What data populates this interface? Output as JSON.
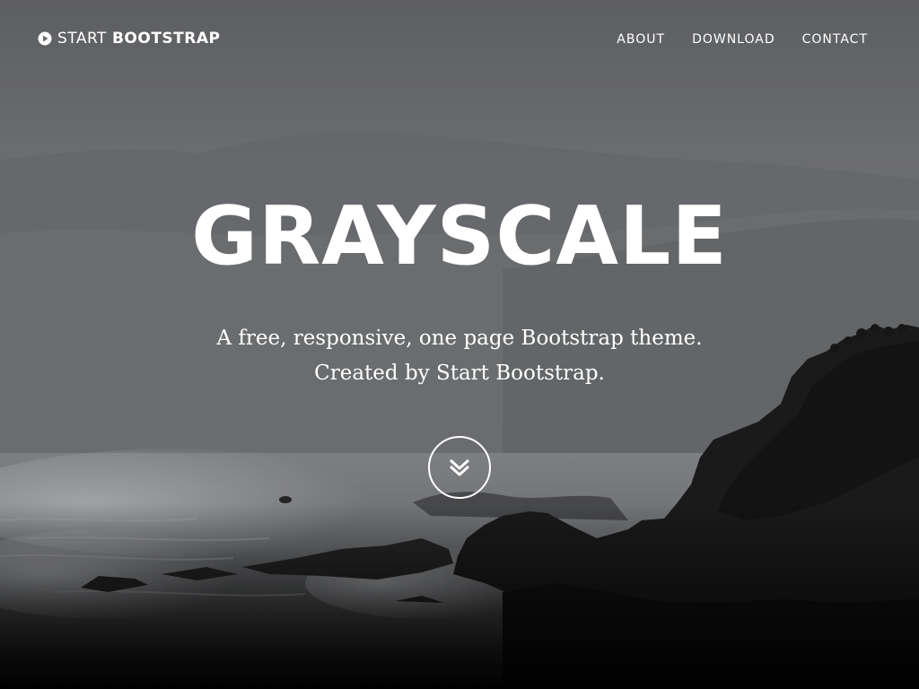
{
  "brand": {
    "prefix": "START",
    "name": "BOOTSTRAP",
    "icon": "play-circle-icon"
  },
  "nav": {
    "items": [
      {
        "label": "ABOUT"
      },
      {
        "label": "DOWNLOAD"
      },
      {
        "label": "CONTACT"
      }
    ]
  },
  "hero": {
    "title": "GRAYSCALE",
    "subtitle_line1": "A free, responsive, one page Bootstrap theme.",
    "subtitle_line2": "Created by Start Bootstrap.",
    "scroll_icon": "double-chevron-down-icon"
  },
  "colors": {
    "text": "#ffffff",
    "sky": "#6f7174",
    "rock": "#141414"
  }
}
